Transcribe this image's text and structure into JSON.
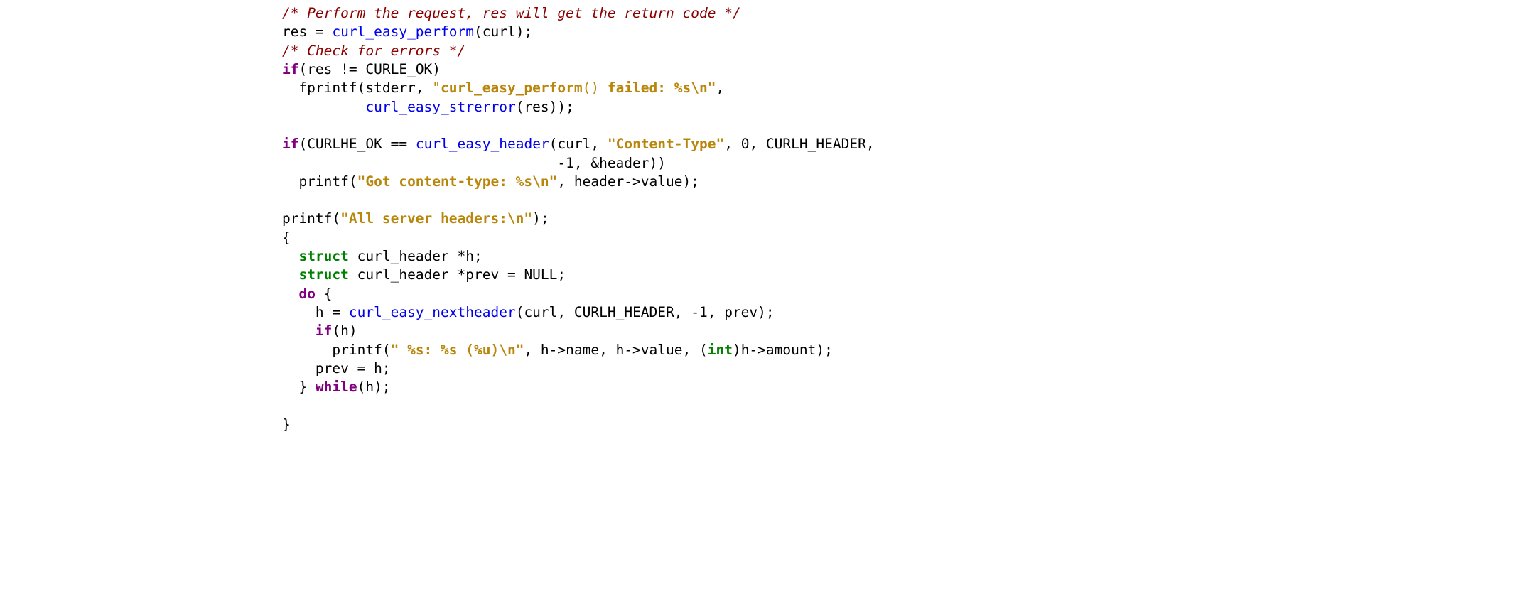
{
  "code": {
    "c1": "/* Perform the request, res will get the return code */",
    "l2a": "    res = ",
    "l2fn": "curl_easy_perform",
    "l2b": "(curl);",
    "c2": "/* Check for errors */",
    "kw_if1": "if",
    "l4": "(res != CURLE_OK)",
    "l5a": "      fprintf(stderr, ",
    "s1a": "\"",
    "s1b": "curl_easy_perform",
    "s1c": "()",
    "s1d": " failed: %s\\n\"",
    "l5b": ",",
    "l6a": "              ",
    "l6fn": "curl_easy_strerror",
    "l6b": "(res));",
    "kw_if2": "if",
    "l8a": "(CURLHE_OK == ",
    "l8fn": "curl_easy_header",
    "l8b": "(curl, ",
    "s2": "\"Content-Type\"",
    "l8c": ", 0, CURLH_HEADER,",
    "l9": "                                     -1, &header))",
    "l10a": "      printf(",
    "s3": "\"Got content-type: %s\\n\"",
    "l10b": ", header->value);",
    "l12a": "    printf(",
    "s4": "\"All server headers:\\n\"",
    "l12b": ");",
    "l13": "    {",
    "kw_struct1": "struct",
    "l14": " curl_header *h;",
    "kw_struct2": "struct",
    "l15": " curl_header *prev = NULL;",
    "kw_do": "do",
    "l16": " {",
    "l17a": "        h = ",
    "l17fn": "curl_easy_nextheader",
    "l17b": "(curl, CURLH_HEADER, -1, prev);",
    "kw_if3": "if",
    "l18": "(h)",
    "l19a": "          printf(",
    "s5": "\" %s: %s (%u)\\n\"",
    "l19b": ", h->name, h->value, (",
    "kw_int": "int",
    "l19c": ")h->amount);",
    "l20": "        prev = h;",
    "l21a": "      } ",
    "kw_while": "while",
    "l21b": "(h);",
    "l23": "    }"
  }
}
